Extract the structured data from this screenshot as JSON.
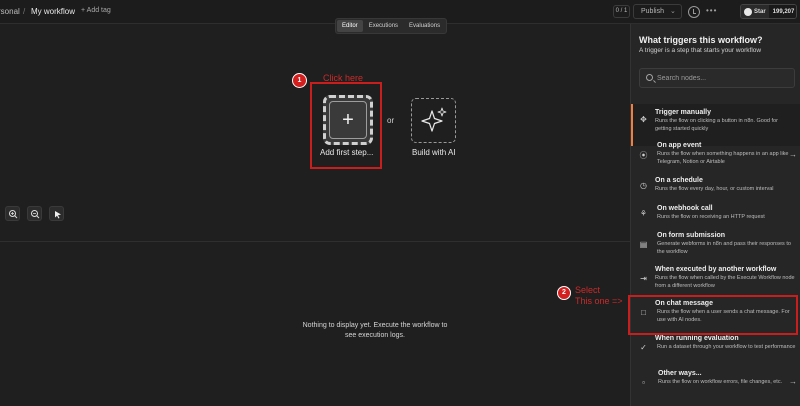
{
  "header": {
    "breadcrumb_personal": "rsonal",
    "breadcrumb_sep": "/",
    "workflow_name": "My workflow",
    "add_tag": "+ Add tag",
    "counter": "0 / 1",
    "publish": "Publish",
    "github_star": "Star",
    "github_count": "199,207"
  },
  "view_tabs": [
    "Editor",
    "Executions",
    "Evaluations"
  ],
  "canvas": {
    "annotation_1_number": "1",
    "annotation_1_text": "Click here",
    "add_first_step": "Add first step...",
    "or": "or",
    "build_with_ai": "Build with AI"
  },
  "logs": {
    "empty_message": "Nothing to display yet. Execute the workflow to see execution logs."
  },
  "panel": {
    "title": "What triggers this workflow?",
    "subtitle": "A trigger is a step that starts your workflow",
    "search_placeholder": "Search nodes...",
    "items": [
      {
        "title": "Trigger manually",
        "desc": "Runs the flow on clicking a button in n8n. Good for getting started quickly",
        "icon": "cursor-click-icon"
      },
      {
        "title": "On app event",
        "desc": "Runs the flow when something happens in an app like Telegram, Notion or Airtable",
        "icon": "satellite-icon"
      },
      {
        "title": "On a schedule",
        "desc": "Runs the flow every day, hour, or custom interval",
        "icon": "clock-icon"
      },
      {
        "title": "On webhook call",
        "desc": "Runs the flow on receiving an HTTP request",
        "icon": "webhook-icon"
      },
      {
        "title": "On form submission",
        "desc": "Generate webforms in n8n and pass their responses to the workflow",
        "icon": "form-icon"
      },
      {
        "title": "When executed by another workflow",
        "desc": "Runs the flow when called by the Execute Workflow node from a different workflow",
        "icon": "sign-in-icon"
      },
      {
        "title": "On chat message",
        "desc": "Runs the flow when a user sends a chat message. For use with AI nodes.",
        "icon": "chat-icon"
      },
      {
        "title": "When running evaluation",
        "desc": "Run a dataset through your workflow to test performance",
        "icon": "check-double-icon"
      },
      {
        "title": "Other ways...",
        "desc": "Runs the flow on workflow errors, file changes, etc.",
        "icon": "folder-icon"
      }
    ]
  },
  "annotation_2": {
    "number": "2",
    "line1": "Select",
    "line2": "This one =>"
  },
  "colors": {
    "annotation_red": "#c81e1e",
    "selected_accent": "#ef7f42",
    "background": "#1f1f1f",
    "panel_background": "#262626"
  }
}
